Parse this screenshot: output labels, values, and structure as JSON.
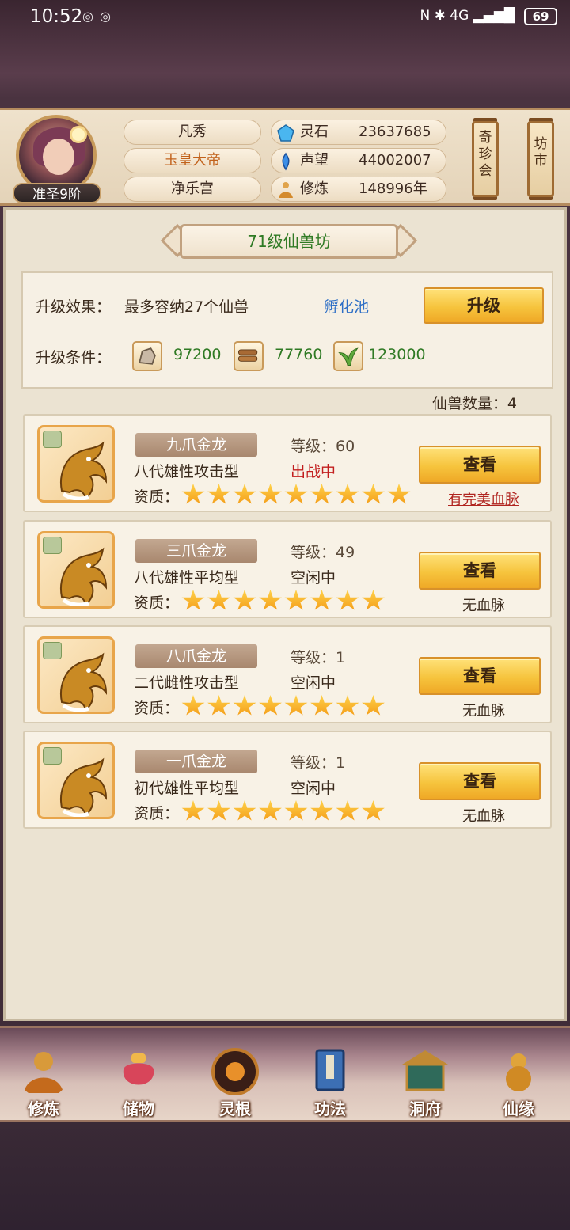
{
  "status_bar": {
    "time": "10:52",
    "battery": "69"
  },
  "player": {
    "rank": "准圣9阶",
    "name_rows": [
      "凡秀",
      "玉皇大帝",
      "净乐宫"
    ]
  },
  "resources": [
    {
      "label": "灵石",
      "value": "23637685",
      "icon": "spirit-stone-icon"
    },
    {
      "label": "声望",
      "value": "44002007",
      "icon": "reputation-icon"
    },
    {
      "label": "修炼",
      "value": "148996年",
      "icon": "cultivation-icon"
    }
  ],
  "side_buttons": {
    "treasure": "奇珍会",
    "market": "坊市"
  },
  "colors": {
    "accent_green": "#2f7a24",
    "active_red": "#c21e1e",
    "link_blue": "#2e6fc6"
  },
  "page": {
    "title": "71级仙兽坊",
    "upgrade_effect_label": "升级效果：",
    "upgrade_effect_value": "最多容纳27个仙兽",
    "hatch_link": "孵化池",
    "upgrade_button": "升级",
    "upgrade_cond_label": "升级条件：",
    "materials": [
      {
        "icon": "ore-icon",
        "value": "97200"
      },
      {
        "icon": "wood-icon",
        "value": "77760"
      },
      {
        "icon": "herb-icon",
        "value": "123000"
      }
    ],
    "pet_count": "仙兽数量：4"
  },
  "pets": [
    {
      "name": "九爪金龙",
      "level": "等级：60",
      "gen": "八代雄性攻击型",
      "status": "出战中",
      "quality_label": "资质：",
      "stars": 9,
      "button": "查看",
      "bloodline": "有完美血脉"
    },
    {
      "name": "三爪金龙",
      "level": "等级：49",
      "gen": "八代雄性平均型",
      "status": "空闲中",
      "quality_label": "资质：",
      "stars": 8,
      "button": "查看",
      "bloodline": "无血脉"
    },
    {
      "name": "八爪金龙",
      "level": "等级：1",
      "gen": "二代雌性攻击型",
      "status": "空闲中",
      "quality_label": "资质：",
      "stars": 8,
      "button": "查看",
      "bloodline": "无血脉"
    },
    {
      "name": "一爪金龙",
      "level": "等级：1",
      "gen": "初代雄性平均型",
      "status": "空闲中",
      "quality_label": "资质：",
      "stars": 8,
      "button": "查看",
      "bloodline": "无血脉"
    }
  ],
  "nav": [
    {
      "label": "修炼",
      "icon": "cultivate-icon"
    },
    {
      "label": "储物",
      "icon": "storage-bag-icon"
    },
    {
      "label": "灵根",
      "icon": "spirit-root-icon"
    },
    {
      "label": "功法",
      "icon": "technique-book-icon"
    },
    {
      "label": "洞府",
      "icon": "cave-mansion-icon"
    },
    {
      "label": "仙缘",
      "icon": "fate-gourd-icon"
    }
  ]
}
